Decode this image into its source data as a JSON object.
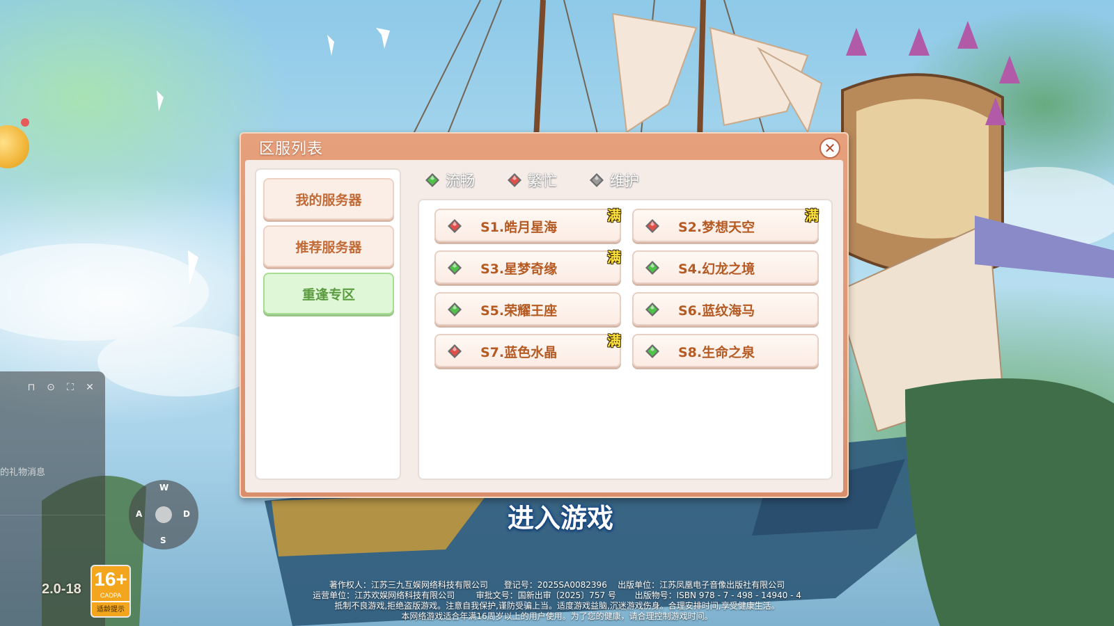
{
  "dialog": {
    "title": "区服列表",
    "close_label": "✕"
  },
  "categories": [
    {
      "label": "我的服务器",
      "active": false
    },
    {
      "label": "推荐服务器",
      "active": false
    },
    {
      "label": "重逢专区",
      "active": true
    }
  ],
  "legend": [
    {
      "label": "流畅",
      "status": "smooth"
    },
    {
      "label": "繁忙",
      "status": "busy"
    },
    {
      "label": "维护",
      "status": "maintenance"
    }
  ],
  "servers": [
    {
      "name": "S1.皓月星海",
      "status": "busy",
      "full_label": "满"
    },
    {
      "name": "S2.梦想天空",
      "status": "busy",
      "full_label": "满"
    },
    {
      "name": "S3.星梦奇缘",
      "status": "smooth",
      "full_label": "满"
    },
    {
      "name": "S4.幻龙之境",
      "status": "smooth",
      "full_label": ""
    },
    {
      "name": "S5.荣耀王座",
      "status": "smooth",
      "full_label": ""
    },
    {
      "name": "S6.蓝纹海马",
      "status": "smooth",
      "full_label": ""
    },
    {
      "name": "S7.蓝色水晶",
      "status": "busy",
      "full_label": "满"
    },
    {
      "name": "S8.生命之泉",
      "status": "smooth",
      "full_label": ""
    }
  ],
  "status_colors": {
    "smooth": "#4fc24a",
    "busy": "#e0504a",
    "maintenance": "#9a9a9a"
  },
  "enter_button": "进入游戏",
  "side_panel": {
    "message": "的礼物消息",
    "tools": [
      "unlock-icon",
      "settings-icon",
      "fullscreen-icon",
      "close-icon"
    ]
  },
  "joystick": {
    "up": "W",
    "left": "A",
    "right": "D",
    "down": "S"
  },
  "version": "2.0-18",
  "age_rating": {
    "label": "16+",
    "org": "CADPA",
    "tip": "适龄提示"
  },
  "footer": {
    "line1": "著作权人：江苏三九互娱网络科技有限公司      登记号：2025SA0082396    出版单位：江苏凤凰电子音像出版社有限公司",
    "line2": "运营单位：江苏欢娱网络科技有限公司        审批文号：国新出审〔2025〕757 号       出版物号：ISBN 978 - 7 - 498 - 14940 - 4",
    "line3": "抵制不良游戏,拒绝盗版游戏。注意自我保护,谨防受骗上当。适度游戏益脑,沉迷游戏伤身。合理安排时间,享受健康生活。",
    "line4": "本网络游戏适合年满16周岁以上的用户使用。为了您的健康，请合理控制游戏时间。"
  }
}
